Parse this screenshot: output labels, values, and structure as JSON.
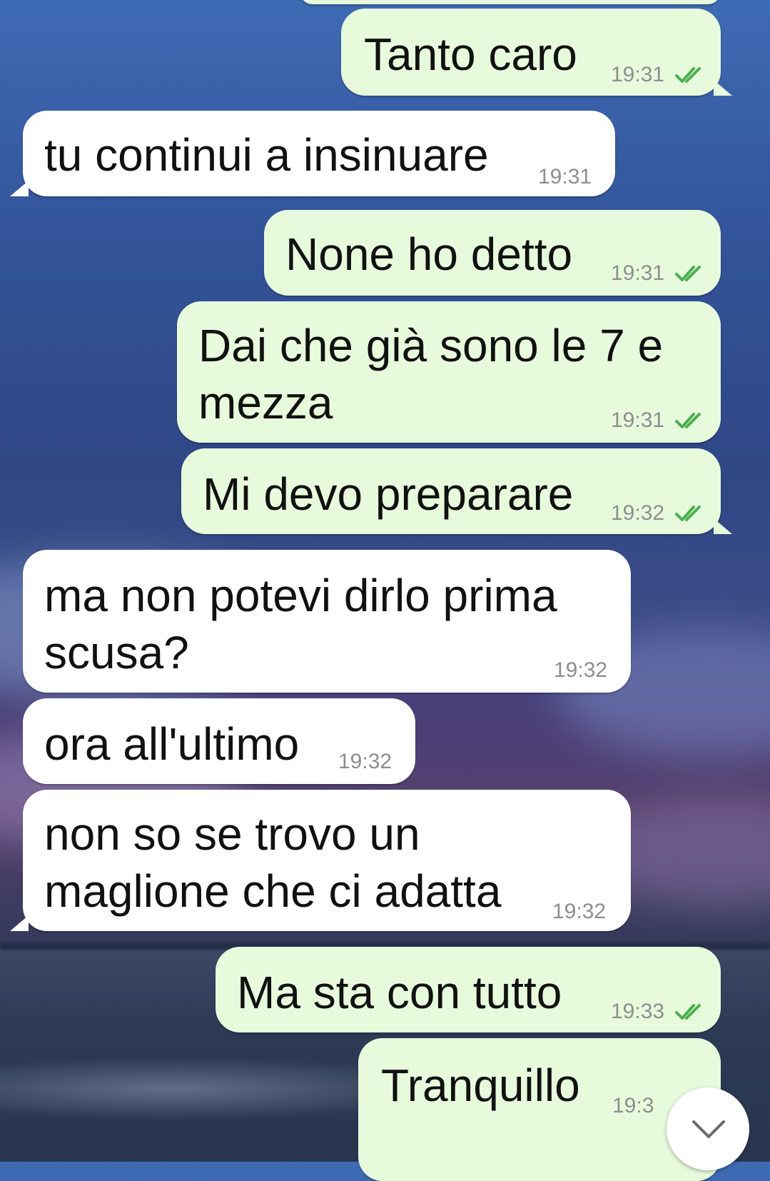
{
  "messages": [
    {
      "dir": "out",
      "text": "Tanto caro",
      "time": "19:31",
      "status": "read"
    },
    {
      "dir": "in",
      "text": "tu continui a insinuare",
      "time": "19:31"
    },
    {
      "dir": "out",
      "text": "None ho detto",
      "time": "19:31",
      "status": "read"
    },
    {
      "dir": "out",
      "text": "Dai che già sono le 7 e\nmezza",
      "time": "19:31",
      "status": "read"
    },
    {
      "dir": "out",
      "text": "Mi devo preparare",
      "time": "19:32",
      "status": "read"
    },
    {
      "dir": "in",
      "text": "ma non potevi dirlo prima\nscusa?",
      "time": "19:32"
    },
    {
      "dir": "in",
      "text": "ora all'ultimo",
      "time": "19:32"
    },
    {
      "dir": "in",
      "text": "non so se trovo un\nmaglione che ci adatta",
      "time": "19:32"
    },
    {
      "dir": "out",
      "text": "Ma sta con tutto",
      "time": "19:33",
      "status": "read"
    },
    {
      "dir": "out",
      "text": "Tranquillo",
      "time": "19:3",
      "status": "read"
    }
  ],
  "colors": {
    "outgoing": "#e7fbdc",
    "incoming": "#ffffff",
    "read_check": "#4caf50",
    "time": "#8e8e8e"
  },
  "icons": {
    "read_receipt": "double-check-icon",
    "scroll_down": "chevron-down-icon"
  }
}
